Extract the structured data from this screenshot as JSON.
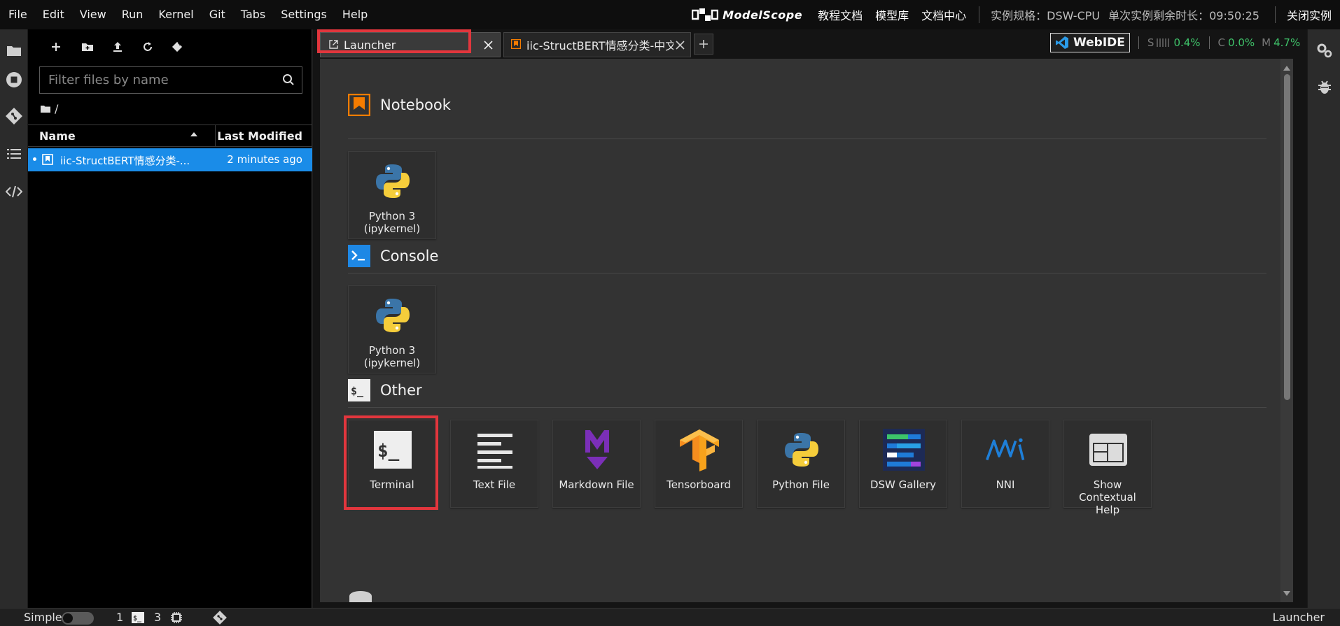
{
  "menubar": {
    "items": [
      "File",
      "Edit",
      "View",
      "Run",
      "Kernel",
      "Git",
      "Tabs",
      "Settings",
      "Help"
    ],
    "brand": "ModelScope",
    "links": [
      "教程文档",
      "模型库",
      "文档中心"
    ],
    "instance_spec": "实例规格：DSW-CPU",
    "remaining_time": "单次实例剩余时长：09:50:25",
    "close_instance": "关闭实例"
  },
  "filebrowser": {
    "filter_placeholder": "Filter files by name",
    "breadcrumb": "/",
    "col_name": "Name",
    "col_modified": "Last Modified",
    "files": [
      {
        "name": "iic-StructBERT情感分类-...",
        "modified": "2 minutes ago"
      }
    ]
  },
  "tabs": {
    "launcher_label": "Launcher",
    "notebook_label": "iic-StructBERT情感分类-中文-"
  },
  "resources": {
    "webide_label": "WebIDE",
    "s_label": "S",
    "s_value": "0.4%",
    "c_label": "C",
    "c_value": "0.0%",
    "m_label": "M",
    "m_value": "4.7%"
  },
  "launcher": {
    "sections": {
      "notebook": "Notebook",
      "console": "Console",
      "other": "Other"
    },
    "notebook_cards": [
      "Python 3\n(ipykernel)"
    ],
    "console_cards": [
      "Python 3\n(ipykernel)"
    ],
    "other_cards": [
      "Terminal",
      "Text File",
      "Markdown File",
      "Tensorboard",
      "Python File",
      "DSW Gallery",
      "NNI",
      "Show Contextual\nHelp"
    ]
  },
  "statusbar": {
    "mode": "Simple",
    "kernels_count": "1",
    "terminals_count": "3",
    "right_label": "Launcher"
  },
  "colors": {
    "selection": "#1a8ce8",
    "highlight_box": "#e2363d",
    "notebook_orange": "#f57c00",
    "console_blue": "#1e88e5",
    "resource_green": "#3fc36a"
  }
}
